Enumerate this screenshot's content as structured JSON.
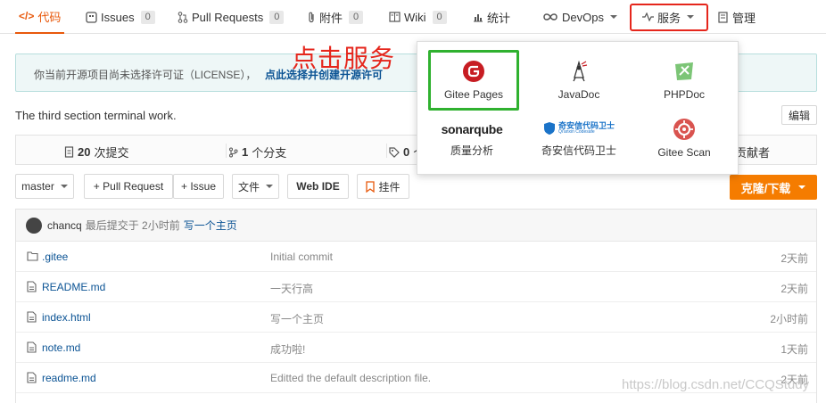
{
  "tabs": [
    {
      "label": "代码",
      "active": true
    },
    {
      "label": "Issues",
      "count": "0"
    },
    {
      "label": "Pull Requests",
      "count": "0"
    },
    {
      "label": "附件",
      "count": "0"
    },
    {
      "label": "Wiki",
      "count": "0"
    },
    {
      "label": "统计"
    },
    {
      "label": "DevOps"
    },
    {
      "label": "服务"
    },
    {
      "label": "管理"
    }
  ],
  "notice": {
    "text": "你当前开源项目尚未选择许可证（LICENSE），",
    "link": "点此选择并创建开源许可",
    "tail": "证"
  },
  "description": "The third section terminal work.",
  "edit_label": "编辑",
  "stats": {
    "commits_num": "20",
    "commits_label": "次提交",
    "branches_num": "1",
    "branches_label": "个分支",
    "tags_num": "0",
    "tags_label": "个",
    "contributors_label": "贡献者"
  },
  "actions": {
    "branch": "master",
    "pull_request": "+ Pull Request",
    "issue": "+ Issue",
    "file": "文件",
    "web_ide": "Web IDE",
    "widget": "挂件",
    "clone": "克隆/下载"
  },
  "last_commit": {
    "user": "chancq",
    "meta": "最后提交于 2小时前",
    "message": "写一个主页"
  },
  "files": [
    {
      "name": ".gitee",
      "type": "folder",
      "message": "Initial commit",
      "time": "2天前"
    },
    {
      "name": "README.md",
      "type": "file",
      "message": "一天行高",
      "time": "2天前"
    },
    {
      "name": "index.html",
      "type": "file",
      "message": "写一个主页",
      "time": "2小时前"
    },
    {
      "name": "note.md",
      "type": "file",
      "message": "成功啦!",
      "time": "1天前"
    },
    {
      "name": "readme.md",
      "type": "file",
      "message": "Editted the default description file.",
      "time": "2天前"
    }
  ],
  "dropdown": [
    {
      "label": "Gitee Pages",
      "icon": "gitee-pages-icon",
      "color": "#c71d23"
    },
    {
      "label": "JavaDoc",
      "icon": "javadoc-icon",
      "color": "#333333"
    },
    {
      "label": "PHPDoc",
      "icon": "phpdoc-icon",
      "color": "#5cb85c"
    },
    {
      "label": "质量分析",
      "icon": "sonarqube-icon",
      "logo_text": "sonarqube",
      "color": "#4e9bcd"
    },
    {
      "label": "奇安信代码卫士",
      "icon": "qianxin-icon",
      "logo_text": "奇安信代码卫士",
      "logo_sub": "Qi'anxin Codesafe",
      "color": "#1a73c8"
    },
    {
      "label": "Gitee Scan",
      "icon": "gitee-scan-icon",
      "color": "#d9534f"
    }
  ],
  "annotation": "点击服务",
  "watermark": "https://blog.csdn.net/CCQStudy",
  "colors": {
    "accent": "#e8590c",
    "clone": "#f57c00",
    "highlight_red": "#e5261c",
    "highlight_green": "#2fb12f",
    "link": "#0b5394"
  }
}
